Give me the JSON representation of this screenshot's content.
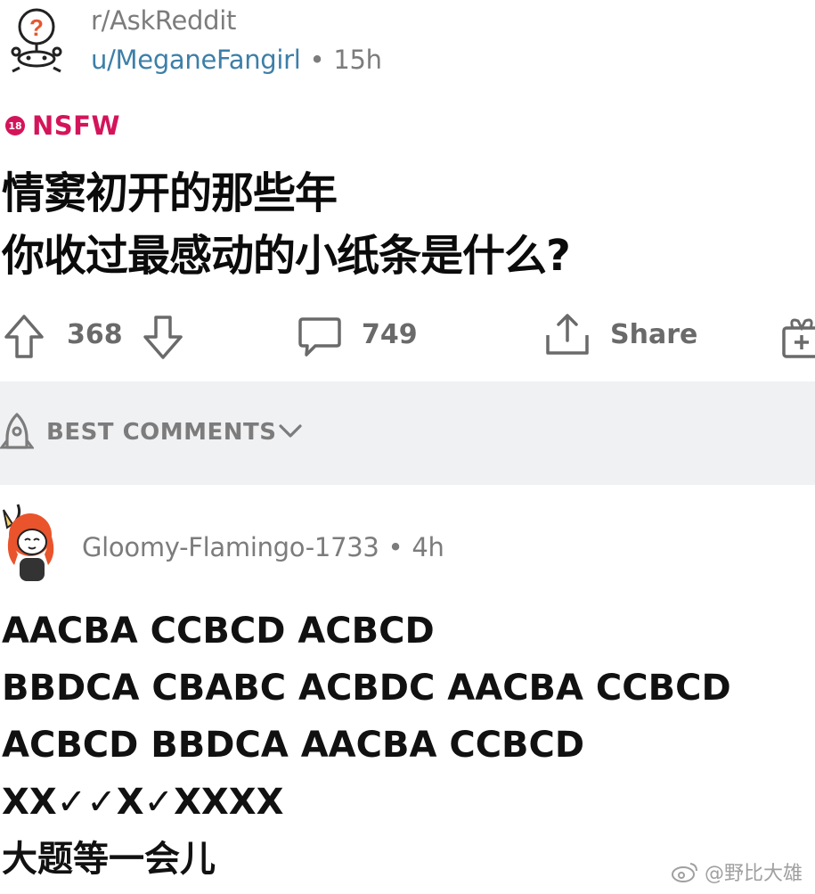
{
  "post": {
    "subreddit": "r/AskReddit",
    "author": "u/MeganeFangirl",
    "separator": "•",
    "age": "15h",
    "nsfw_badge": "18",
    "nsfw_label": "NSFW",
    "title_lines": [
      "情窦初开的那些年",
      "你收过最感动的小纸条是什么?"
    ]
  },
  "actions": {
    "upvote_icon": "upvote-arrow-icon",
    "score": "368",
    "downvote_icon": "downvote-arrow-icon",
    "comment_icon": "speech-bubble-icon",
    "comments": "749",
    "share_icon": "share-upload-icon",
    "share_label": "Share",
    "award_icon": "gift-icon"
  },
  "sort": {
    "icon": "rocket-icon",
    "label": "BEST COMMENTS",
    "chevron_icon": "chevron-down-icon",
    "background": "#f0f1f3"
  },
  "comment": {
    "author": "Gloomy-Flamingo-1733",
    "separator": "•",
    "age": "4h",
    "lines": [
      "AACBA CCBCD ACBCD",
      "BBDCA CBABC ACBDC AACBA CCBCD",
      "ACBCD BBDCA AACBA CCBCD",
      "XX✓✓X✓XXXX",
      "大题等一会儿"
    ]
  },
  "watermark": {
    "icon": "weibo-icon",
    "text": "@野比大雄"
  },
  "colors": {
    "nsfw": "#d4145a",
    "author_link": "#3d7fa8",
    "meta_gray": "#7c7c7c"
  }
}
